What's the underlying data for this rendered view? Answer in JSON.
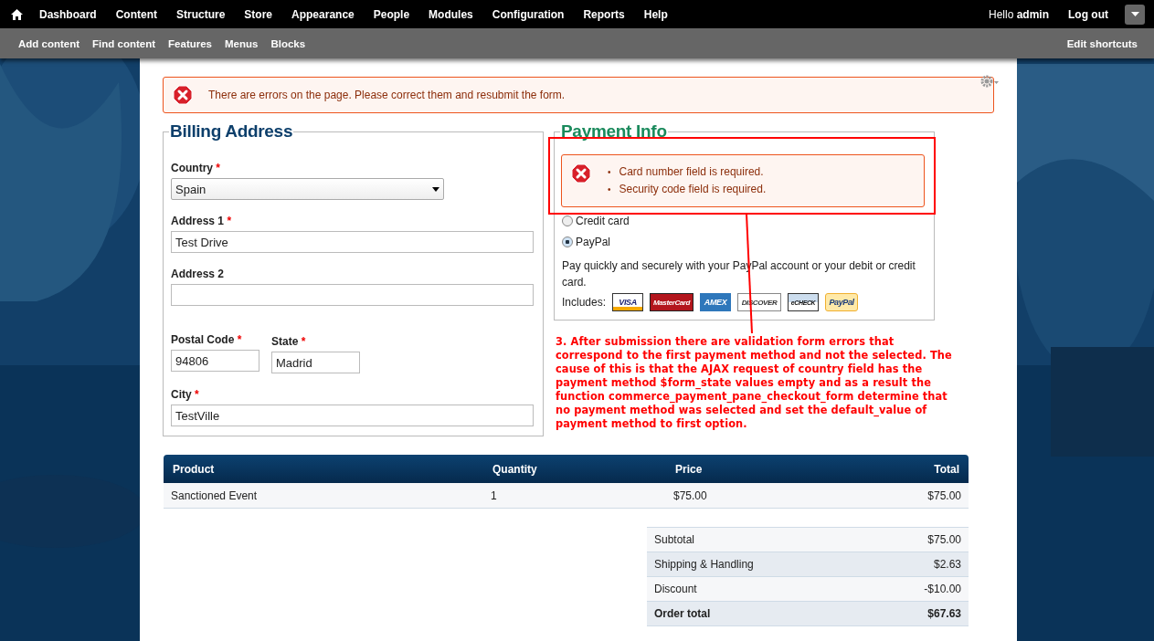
{
  "toolbar": {
    "menu": [
      {
        "label": "Dashboard"
      },
      {
        "label": "Content"
      },
      {
        "label": "Structure"
      },
      {
        "label": "Store"
      },
      {
        "label": "Appearance"
      },
      {
        "label": "People"
      },
      {
        "label": "Modules"
      },
      {
        "label": "Configuration"
      },
      {
        "label": "Reports"
      },
      {
        "label": "Help"
      }
    ],
    "greeting": "Hello **admin**",
    "logout": "Log out"
  },
  "shortcuts": {
    "items": [
      {
        "label": "Add content"
      },
      {
        "label": "Find content"
      },
      {
        "label": "Features"
      },
      {
        "label": "Menus"
      },
      {
        "label": "Blocks"
      }
    ],
    "edit": "Edit shortcuts"
  },
  "page_error": "There are errors on the page. Please correct them and resubmit the form.",
  "billing": {
    "legend": "Billing Address",
    "fields": [
      {
        "label": "Country",
        "required_mark": "*",
        "kind": "select",
        "value": "Spain"
      },
      {
        "label": "Address 1",
        "required_mark": "*",
        "kind": "text",
        "value": "Test Drive"
      },
      {
        "label": "Address 2",
        "kind": "text"
      },
      {
        "label": "Postal Code",
        "required_mark": "*",
        "kind": "short",
        "value": "94806"
      },
      {
        "label": "State",
        "required_mark": "*",
        "kind": "short",
        "value": "Madrid"
      },
      {
        "label": "City",
        "required_mark": "*",
        "kind": "text",
        "value": "TestVille"
      }
    ]
  },
  "payment": {
    "legend": "Payment Info",
    "bullet": "•",
    "errors": [
      "Card number field is required.",
      "Security code field is required."
    ],
    "methods": [
      {
        "label": "Credit card",
        "selected": false
      },
      {
        "label": "PayPal",
        "selected": true
      }
    ],
    "description": "Pay quickly and securely with your PayPal account or your debit or credit card.",
    "includes": "Includes:",
    "cards": [
      {
        "label": "VISA",
        "kind": "visa"
      },
      {
        "label": "MasterCard",
        "kind": "mastercard"
      },
      {
        "label": "AMEX",
        "kind": "amex"
      },
      {
        "label": "DISCOVER",
        "kind": "discover"
      },
      {
        "label": "eCHECK",
        "kind": "echeck"
      },
      {
        "label": "PayPal",
        "kind": "paypal"
      }
    ]
  },
  "annotation": "3. After submission there are validation form errors that correspond to the first payment method and not the selected. The cause of this is that the AJAX request of country field has the payment method $form_state values empty and as a result the function commerce_payment_pane_checkout_form determine that no payment method was selected and set the default_value of payment method to first option.",
  "cart": {
    "columns": [
      "Product",
      "Quantity",
      "Price",
      "Total"
    ],
    "rows": [
      [
        "Sanctioned Event",
        "1",
        "$75.00",
        "$75.00"
      ]
    ]
  },
  "totals": [
    {
      "label": "Subtotal",
      "amount": "$75.00",
      "grand": false
    },
    {
      "label": "Shipping & Handling",
      "amount": "$2.63",
      "grand": false
    },
    {
      "label": "Discount",
      "amount": "-$10.00",
      "grand": false
    },
    {
      "label": "Order total",
      "amount": "$67.63",
      "grand": true
    }
  ]
}
